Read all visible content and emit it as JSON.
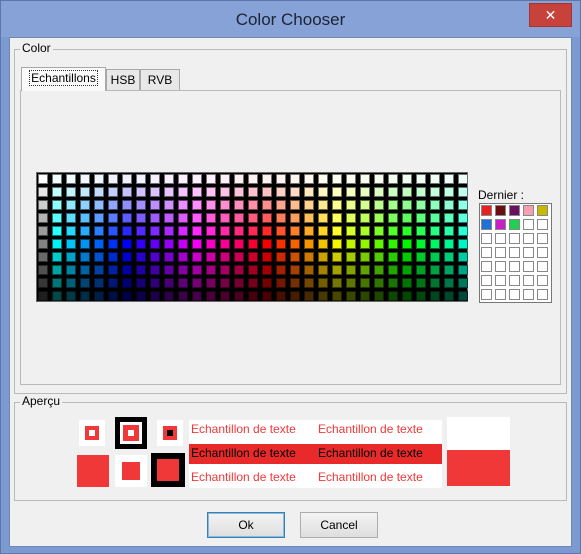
{
  "window": {
    "title": "Color Chooser",
    "close_symbol": "✕"
  },
  "color_group": {
    "label": "Color"
  },
  "tabs": [
    {
      "label": "Echantillons",
      "active": true
    },
    {
      "label": "HSB",
      "active": false
    },
    {
      "label": "RVB",
      "active": false
    }
  ],
  "recent": {
    "label": "Dernier :",
    "colors": [
      "#e82020",
      "#6a1010",
      "#6a1060",
      "#f4a0b0",
      "#c8b800",
      "#1f70d8",
      "#c820c8",
      "#20d050"
    ]
  },
  "preview": {
    "label": "Aperçu",
    "sample_text": "Echantillon de texte",
    "foreground_color": "#f03838",
    "highlight_color": "#e82a2a"
  },
  "buttons": {
    "ok": "Ok",
    "cancel": "Cancel"
  },
  "palette": {
    "columns": 31,
    "rows": 10
  }
}
